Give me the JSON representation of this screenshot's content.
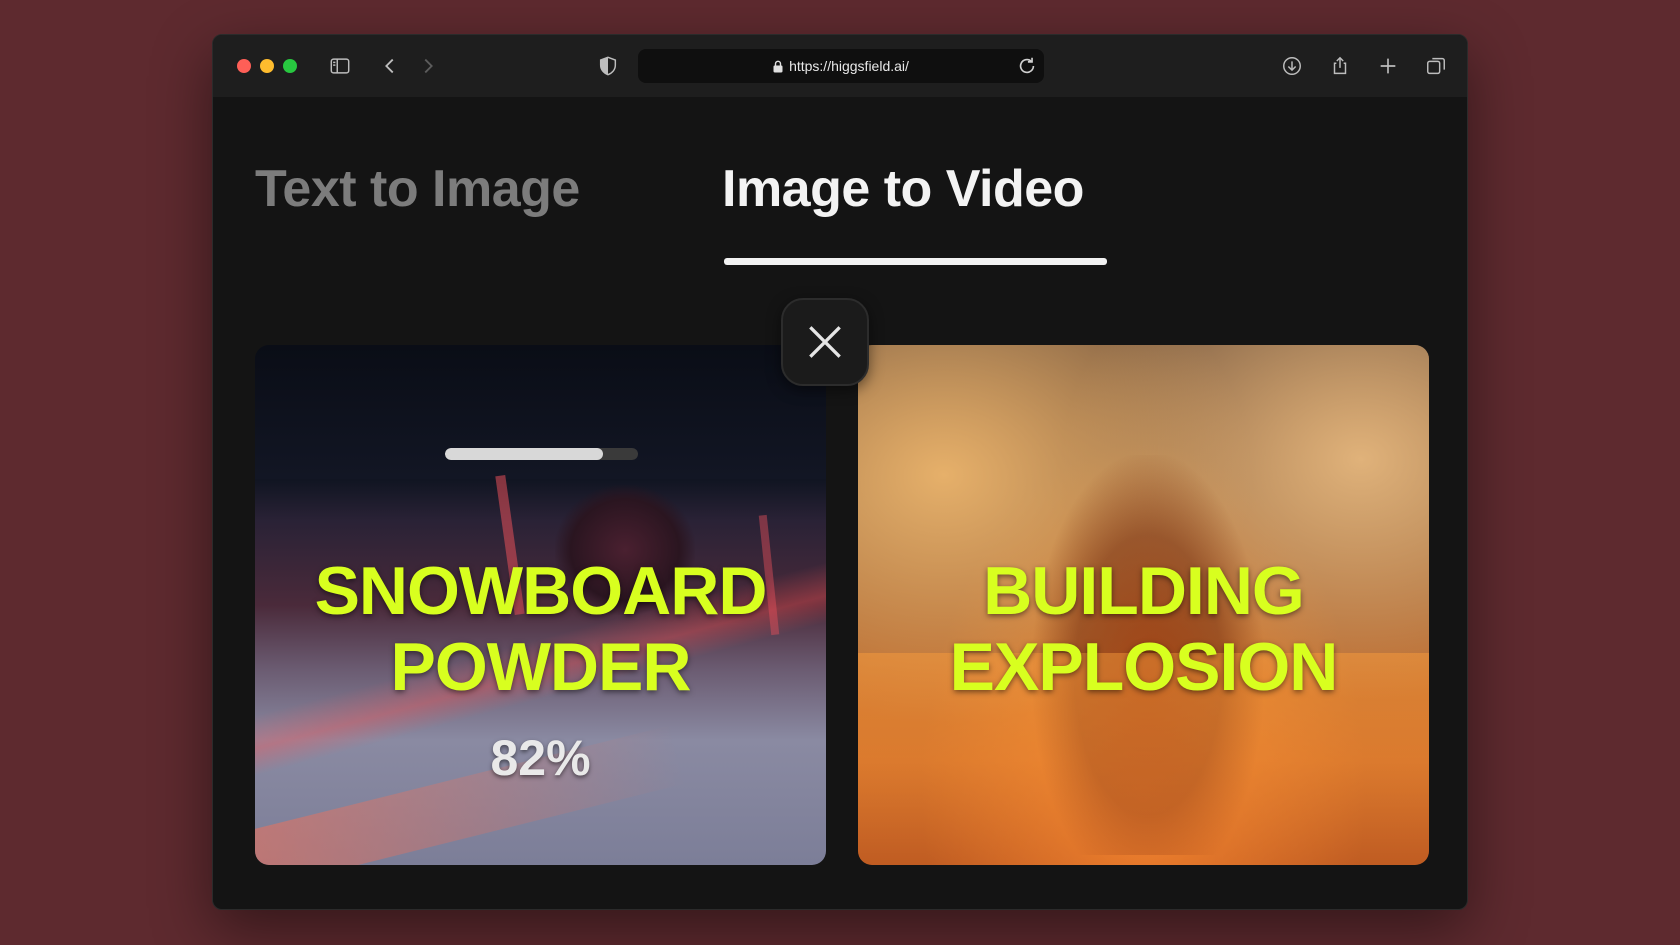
{
  "browser": {
    "url": "https://higgsfield.ai/",
    "icons": {
      "sidebar": "sidebar-icon",
      "back": "chevron-left-icon",
      "forward": "chevron-right-icon",
      "shield": "shield-icon",
      "lock": "lock-icon",
      "reload": "reload-icon",
      "download": "download-icon",
      "share": "share-icon",
      "new_tab": "plus-icon",
      "tabs": "tabs-overview-icon"
    }
  },
  "tabs": [
    {
      "label": "Text to Image",
      "active": false
    },
    {
      "label": "Image to Video",
      "active": true
    }
  ],
  "close_icon": "close-icon",
  "cards": [
    {
      "title_line1": "SNOWBOARD",
      "title_line2": "POWDER",
      "progress_label": "82%",
      "progress": 0.82
    },
    {
      "title_line1": "BUILDING",
      "title_line2": "EXPLOSION"
    }
  ],
  "colors": {
    "accent_text": "#d8ff1f",
    "background": "#5e2a2f",
    "panel": "#141414"
  }
}
